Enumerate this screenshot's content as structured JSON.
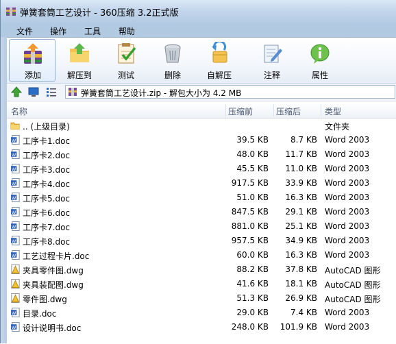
{
  "window": {
    "title": "弹簧套筒工艺设计 - 360压缩 3.2正式版"
  },
  "menu": [
    "文件",
    "操作",
    "工具",
    "帮助"
  ],
  "toolbar": [
    {
      "label": "添加",
      "icon": "add-archive-icon"
    },
    {
      "label": "解压到",
      "icon": "extract-folder-icon"
    },
    {
      "label": "测试",
      "icon": "test-checklist-icon"
    },
    {
      "label": "删除",
      "icon": "trash-bin-icon"
    },
    {
      "label": "自解压",
      "icon": "self-extract-icon"
    },
    {
      "label": "注释",
      "icon": "comment-note-icon"
    },
    {
      "label": "属性",
      "icon": "info-properties-icon"
    }
  ],
  "address": {
    "text": "弹簧套筒工艺设计.zip - 解包大小为 4.2 MB"
  },
  "columns": {
    "name": "名称",
    "size": "压缩前",
    "packed": "压缩后",
    "type": "类型"
  },
  "files": [
    {
      "name": ".. (上级目录)",
      "size": "",
      "packed": "",
      "type": "文件夹",
      "icon": "folder-icon"
    },
    {
      "name": "工序卡1.doc",
      "size": "39.5 KB",
      "packed": "8.7 KB",
      "type": "Word 2003",
      "icon": "word-doc-icon"
    },
    {
      "name": "工序卡2.doc",
      "size": "48.0 KB",
      "packed": "11.7 KB",
      "type": "Word 2003",
      "icon": "word-doc-icon"
    },
    {
      "name": "工序卡3.doc",
      "size": "45.5 KB",
      "packed": "11.0 KB",
      "type": "Word 2003",
      "icon": "word-doc-icon"
    },
    {
      "name": "工序卡4.doc",
      "size": "917.5 KB",
      "packed": "33.9 KB",
      "type": "Word 2003",
      "icon": "word-doc-icon"
    },
    {
      "name": "工序卡5.doc",
      "size": "51.0 KB",
      "packed": "16.3 KB",
      "type": "Word 2003",
      "icon": "word-doc-icon"
    },
    {
      "name": "工序卡6.doc",
      "size": "847.5 KB",
      "packed": "29.1 KB",
      "type": "Word 2003",
      "icon": "word-doc-icon"
    },
    {
      "name": "工序卡7.doc",
      "size": "881.0 KB",
      "packed": "25.1 KB",
      "type": "Word 2003",
      "icon": "word-doc-icon"
    },
    {
      "name": "工序卡8.doc",
      "size": "957.5 KB",
      "packed": "34.9 KB",
      "type": "Word 2003",
      "icon": "word-doc-icon"
    },
    {
      "name": "工艺过程卡片.doc",
      "size": "60.0 KB",
      "packed": "16.3 KB",
      "type": "Word 2003",
      "icon": "word-doc-icon"
    },
    {
      "name": "夹具零件图.dwg",
      "size": "88.2 KB",
      "packed": "37.8 KB",
      "type": "AutoCAD 图形",
      "icon": "autocad-dwg-icon"
    },
    {
      "name": "夹具装配图.dwg",
      "size": "41.6 KB",
      "packed": "18.1 KB",
      "type": "AutoCAD 图形",
      "icon": "autocad-dwg-icon"
    },
    {
      "name": "零件图.dwg",
      "size": "51.3 KB",
      "packed": "26.9 KB",
      "type": "AutoCAD 图形",
      "icon": "autocad-dwg-icon"
    },
    {
      "name": "目录.doc",
      "size": "29.0 KB",
      "packed": "7.4 KB",
      "type": "Word 2003",
      "icon": "word-doc-icon"
    },
    {
      "name": "设计说明书.doc",
      "size": "248.0 KB",
      "packed": "101.9 KB",
      "type": "Word 2003",
      "icon": "word-doc-icon"
    }
  ]
}
